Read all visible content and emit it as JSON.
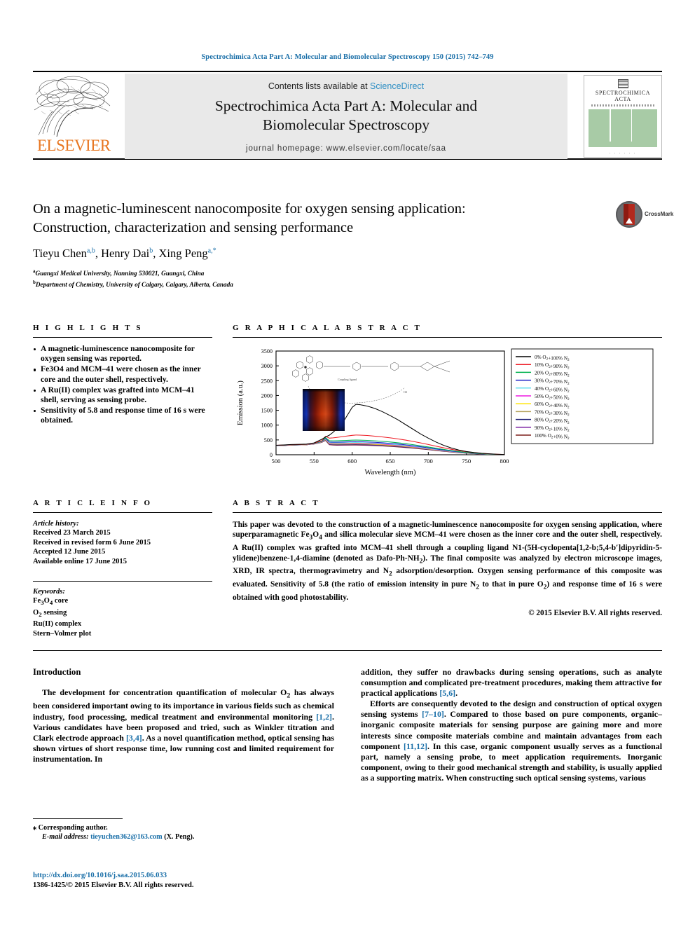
{
  "running_head": "Spectrochimica Acta Part A: Molecular and Biomolecular Spectroscopy 150 (2015) 742–749",
  "masthead": {
    "contents_prefix": "Contents lists available at ",
    "sciencedirect": "ScienceDirect",
    "journal_title_line1": "Spectrochimica Acta Part A: Molecular and",
    "journal_title_line2": "Biomolecular Spectroscopy",
    "homepage": "journal homepage: www.elsevier.com/locate/saa",
    "publisher": "ELSEVIER",
    "cover_title_line1": "SPECTROCHIMICA",
    "cover_title_line2": "ACTA",
    "cover_dots": ". . . . . ."
  },
  "article": {
    "title": "On a magnetic-luminescent nanocomposite for oxygen sensing application: Construction, characterization and sensing performance",
    "authors": [
      {
        "name": "Tieyu Chen",
        "sup": "a,b"
      },
      {
        "name": "Henry Dai",
        "sup": "b"
      },
      {
        "name": "Xing Peng",
        "sup": "a,*"
      }
    ],
    "affiliations": [
      {
        "sup": "a",
        "text": "Guangxi Medical University, Nanning 530021, Guangxi, China"
      },
      {
        "sup": "b",
        "text": "Department of Chemistry, University of Calgary, Calgary, Alberta, Canada"
      }
    ],
    "crossmark_label": "CrossMark"
  },
  "highlights": {
    "heading": "H I G H L I G H T S",
    "items": [
      "A magnetic-luminescence nanocomposite for oxygen sensing was reported.",
      "Fe3O4 and MCM–41 were chosen as the inner core and the outer shell, respectively.",
      "A Ru(II) complex was grafted into MCM–41 shell, serving as sensing probe.",
      "Sensitivity of 5.8 and response time of 16 s were obtained."
    ]
  },
  "graphical_abstract": {
    "heading": "G R A P H I C A L   A B S T R A C T"
  },
  "article_info": {
    "heading": "A R T I C L E    I N F O",
    "history_label": "Article history:",
    "history": [
      "Received 23 March 2015",
      "Received in revised form 6 June 2015",
      "Accepted 12 June 2015",
      "Available online 17 June 2015"
    ],
    "keywords_label": "Keywords:",
    "keywords": [
      "Fe3O4 core",
      "O2 sensing",
      "Ru(II) complex",
      "Stern–Volmer plot"
    ]
  },
  "abstract": {
    "heading": "A B S T R A C T",
    "text": "This paper was devoted to the construction of a magnetic-luminescence nanocomposite for oxygen sensing application, where superparamagnetic Fe3O4 and silica molecular sieve MCM–41 were chosen as the inner core and the outer shell, respectively. A Ru(II) complex was grafted into MCM–41 shell through a coupling ligand N1-(5H-cyclopenta[1,2-b;5,4-b′]dipyridin-5-ylidene)benzene-1,4-diamine (denoted as Dafo-Ph-NH2). The final composite was analyzed by electron microscope images, XRD, IR spectra, thermogravimetry and N2 adsorption/desorption. Oxygen sensing performance of this composite was evaluated. Sensitivity of 5.8 (the ratio of emission intensity in pure N2 to that in pure O2) and response time of 16 s were obtained with good photostability.",
    "copyright": "© 2015 Elsevier B.V. All rights reserved."
  },
  "introduction": {
    "heading": "Introduction",
    "left_paragraphs": [
      "The development for concentration quantification of molecular O2 has always been considered important owing to its importance in various fields such as chemical industry, food processing, medical treatment and environmental monitoring [1,2]. Various candidates have been proposed and tried, such as Winkler titration and Clark electrode approach [3,4]. As a novel quantification method, optical sensing has shown virtues of short response time, low running cost and limited requirement for instrumentation. In"
    ],
    "right_paragraphs": [
      "addition, they suffer no drawbacks during sensing operations, such as analyte consumption and complicated pre-treatment procedures, making them attractive for practical applications [5,6].",
      "Efforts are consequently devoted to the design and construction of optical oxygen sensing systems [7–10]. Compared to those based on pure components, organic–inorganic composite materials for sensing purpose are gaining more and more interests since composite materials combine and maintain advantages from each component [11,12]. In this case, organic component usually serves as a functional part, namely a sensing probe, to meet application requirements. Inorganic component, owing to their good mechanical strength and stability, is usually applied as a supporting matrix. When constructing such optical sensing systems, various"
    ]
  },
  "footer": {
    "corresponding_marker": "⁎",
    "corresponding": "Corresponding author.",
    "email_label": "E-mail address:",
    "email": "tieyuchen362@163.com",
    "email_suffix": "(X. Peng).",
    "doi": "http://dx.doi.org/10.1016/j.saa.2015.06.033",
    "issn_line": "1386-1425/© 2015 Elsevier B.V. All rights reserved."
  },
  "chart_data": {
    "type": "line",
    "title": "",
    "xlabel": "Wavelength (nm)",
    "ylabel": "Emission (a.u.)",
    "xlim": [
      500,
      800
    ],
    "ylim": [
      0,
      3500
    ],
    "xticks": [
      500,
      550,
      600,
      650,
      700,
      750,
      800
    ],
    "yticks": [
      0,
      500,
      1000,
      1500,
      2000,
      2500,
      3000,
      3500
    ],
    "grid": false,
    "legend_position": "right",
    "inset_labels": {
      "coupling": "Coupling ligand",
      "left_vial": "N2",
      "right_vial": "O2"
    },
    "x": [
      500,
      510,
      520,
      530,
      540,
      550,
      560,
      565,
      570,
      575,
      580,
      590,
      600,
      605,
      610,
      620,
      630,
      640,
      650,
      660,
      670,
      680,
      690,
      700,
      710,
      720,
      730,
      740,
      750,
      760,
      770,
      780,
      790,
      800
    ],
    "series": [
      {
        "name": "0% O2+100% N2",
        "color": "#000000",
        "values": [
          320,
          330,
          345,
          350,
          360,
          400,
          520,
          600,
          660,
          760,
          880,
          1180,
          1600,
          1700,
          1690,
          1640,
          1560,
          1450,
          1320,
          1180,
          1020,
          860,
          700,
          560,
          430,
          320,
          230,
          160,
          110,
          75,
          50,
          32,
          18,
          8
        ]
      },
      {
        "name": "10% O2+90% N2",
        "color": "#ee1c25",
        "values": [
          318,
          326,
          338,
          344,
          352,
          392,
          470,
          620,
          560,
          570,
          585,
          620,
          655,
          665,
          662,
          650,
          625,
          600,
          570,
          535,
          495,
          450,
          400,
          345,
          290,
          235,
          185,
          140,
          100,
          70,
          48,
          30,
          16,
          7
        ]
      },
      {
        "name": "20% O2+80% N2",
        "color": "#00b14f",
        "values": [
          316,
          324,
          336,
          342,
          350,
          388,
          455,
          575,
          475,
          470,
          472,
          480,
          492,
          495,
          492,
          484,
          470,
          452,
          430,
          404,
          374,
          340,
          302,
          262,
          220,
          180,
          142,
          108,
          78,
          54,
          36,
          22,
          12,
          6
        ]
      },
      {
        "name": "30% O2+70% N2",
        "color": "#1f23c8",
        "values": [
          314,
          322,
          334,
          340,
          348,
          384,
          448,
          555,
          430,
          424,
          424,
          430,
          440,
          443,
          440,
          432,
          420,
          404,
          384,
          362,
          334,
          304,
          270,
          234,
          196,
          160,
          126,
          96,
          70,
          48,
          32,
          20,
          11,
          5
        ]
      },
      {
        "name": "40% O2+60% N2",
        "color": "#66e0ef",
        "values": [
          312,
          320,
          332,
          338,
          346,
          380,
          442,
          540,
          408,
          400,
          398,
          402,
          410,
          412,
          410,
          402,
          390,
          375,
          357,
          336,
          310,
          282,
          250,
          217,
          182,
          148,
          117,
          89,
          65,
          45,
          30,
          18,
          10,
          5
        ]
      },
      {
        "name": "50% O2+50% N2",
        "color": "#ee18e2",
        "values": [
          311,
          318,
          330,
          336,
          344,
          377,
          437,
          528,
          392,
          384,
          381,
          384,
          391,
          393,
          391,
          383,
          372,
          357,
          340,
          320,
          295,
          268,
          238,
          207,
          173,
          141,
          111,
          85,
          62,
          43,
          28,
          17,
          9,
          4
        ]
      },
      {
        "name": "60% O2+40% N2",
        "color": "#ffe400",
        "values": [
          310,
          317,
          329,
          335,
          342,
          374,
          432,
          518,
          379,
          371,
          367,
          370,
          376,
          378,
          376,
          368,
          357,
          343,
          326,
          307,
          283,
          257,
          228,
          198,
          166,
          135,
          107,
          81,
          59,
          41,
          27,
          16,
          9,
          4
        ]
      },
      {
        "name": "70% O2+30% N2",
        "color": "#b4a35c",
        "values": [
          309,
          316,
          327,
          333,
          341,
          371,
          428,
          509,
          368,
          359,
          355,
          357,
          362,
          364,
          362,
          355,
          344,
          330,
          314,
          295,
          272,
          247,
          219,
          190,
          160,
          130,
          103,
          78,
          57,
          39,
          26,
          16,
          8,
          4
        ]
      },
      {
        "name": "80% O2+20% N2",
        "color": "#191970",
        "values": [
          308,
          315,
          326,
          332,
          339,
          368,
          424,
          500,
          357,
          348,
          343,
          345,
          349,
          351,
          349,
          342,
          332,
          318,
          303,
          285,
          262,
          238,
          211,
          183,
          154,
          125,
          99,
          75,
          55,
          38,
          25,
          15,
          8,
          3
        ]
      },
      {
        "name": "90% O2+10% N2",
        "color": "#7b1fa2",
        "values": [
          307,
          314,
          325,
          331,
          338,
          365,
          420,
          492,
          347,
          337,
          332,
          333,
          337,
          338,
          336,
          330,
          320,
          307,
          292,
          275,
          253,
          230,
          204,
          177,
          148,
          121,
          95,
          72,
          53,
          36,
          24,
          14,
          8,
          3
        ]
      },
      {
        "name": "100% O2+0% N2",
        "color": "#7d1f1a",
        "values": [
          306,
          313,
          324,
          330,
          337,
          362,
          416,
          485,
          337,
          327,
          321,
          322,
          325,
          326,
          324,
          318,
          309,
          296,
          282,
          265,
          244,
          222,
          197,
          171,
          143,
          116,
          92,
          70,
          51,
          35,
          23,
          14,
          7,
          3
        ]
      }
    ]
  }
}
